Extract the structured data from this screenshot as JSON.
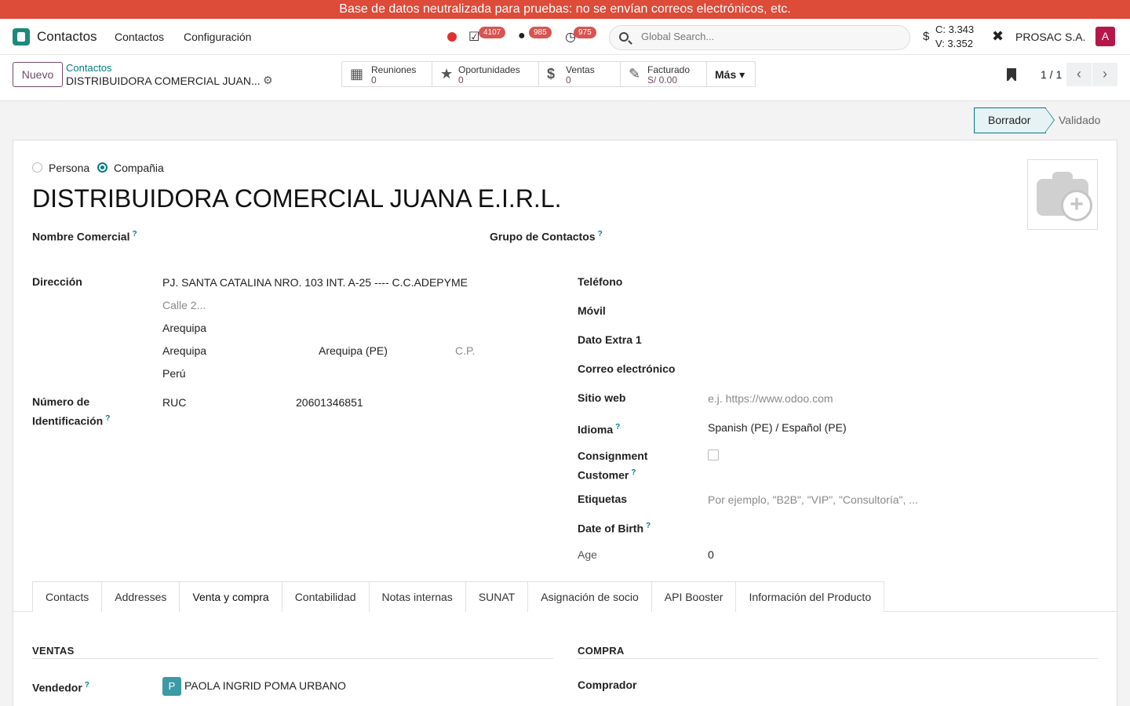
{
  "banner": "Base de datos neutralizada para pruebas: no se envían correos electrónicos, etc.",
  "navbar": {
    "app_name": "Contactos",
    "menu": [
      "Contactos",
      "Configuración"
    ],
    "activity_count": "4107",
    "messages_count": "985",
    "clock_count": "975",
    "search_placeholder": "Global Search...",
    "currency_symbol": "$",
    "rate_buy": "C: 3.343",
    "rate_sell": "V: 3.352",
    "company": "PROSAC S.A.",
    "user_initial": "A",
    "icons": [
      "recording-dot-icon",
      "activity-check-icon",
      "chat-icon",
      "clock-icon",
      "search-icon",
      "dollar-icon",
      "tools-icon"
    ]
  },
  "control": {
    "new_label": "Nuevo",
    "breadcrumb_parent": "Contactos",
    "breadcrumb_current": "DISTRIBUIDORA COMERCIAL JUAN...",
    "smart_buttons": [
      {
        "label": "Reuniones",
        "value": "0",
        "icon": "calendar-icon"
      },
      {
        "label": "Oportunidades",
        "value": "0",
        "icon": "star-icon"
      },
      {
        "label": "Ventas",
        "value": "0",
        "icon": "dollar-icon"
      },
      {
        "label": "Facturado",
        "value": "S/ 0.00",
        "icon": "edit-invoice-icon"
      }
    ],
    "more_label": "Más",
    "pager": "1 / 1"
  },
  "status": {
    "current": "Borrador",
    "next": "Validado"
  },
  "form": {
    "type_person": "Persona",
    "type_company": "Compañia",
    "name": "DISTRIBUIDORA COMERCIAL JUANA E.I.R.L.",
    "trade_name_label": "Nombre Comercial",
    "contact_group_label": "Grupo de Contactos",
    "address_label": "Dirección",
    "street": "PJ. SANTA CATALINA NRO. 103 INT. A-25 ---- C.C.ADEPYME",
    "street2_placeholder": "Calle 2...",
    "district": "Arequipa",
    "city": "Arequipa",
    "state": "Arequipa (PE)",
    "zip_placeholder": "C.P.",
    "country": "Perú",
    "id_label_1": "Número de",
    "id_label_2": "Identificación",
    "id_type": "RUC",
    "id_number": "20601346851",
    "phone_label": "Teléfono",
    "mobile_label": "Móvil",
    "extra_label": "Dato Extra 1",
    "email_label": "Correo electrónico",
    "website_label": "Sitio web",
    "website_placeholder": "e.j. https://www.odoo.com",
    "language_label": "Idioma",
    "language_value": "Spanish (PE) / Español (PE)",
    "consignment_label_1": "Consignment",
    "consignment_label_2": "Customer",
    "tags_label": "Etiquetas",
    "tags_placeholder": "Por ejemplo, \"B2B\", \"VIP\", \"Consultoría\", ...",
    "dob_label": "Date of Birth",
    "age_label": "Age",
    "age_value": "0",
    "help_mark": "?"
  },
  "tabs": [
    "Contacts",
    "Addresses",
    "Venta y compra",
    "Contabilidad",
    "Notas internas",
    "SUNAT",
    "Asignación de socio",
    "API Booster",
    "Información del Producto"
  ],
  "active_tab": "Venta y compra",
  "sales": {
    "section": "VENTAS",
    "salesperson_label": "Vendedor",
    "salesperson_initial": "P",
    "salesperson": "PAOLA INGRID POMA URBANO"
  },
  "purchase": {
    "section": "COMPRA",
    "buyer_label": "Comprador"
  },
  "colors": {
    "banner": "#dd4b39",
    "primary": "#714b67",
    "accent": "#017e84",
    "badge": "#d9534f",
    "avatar": "#b5174b"
  }
}
